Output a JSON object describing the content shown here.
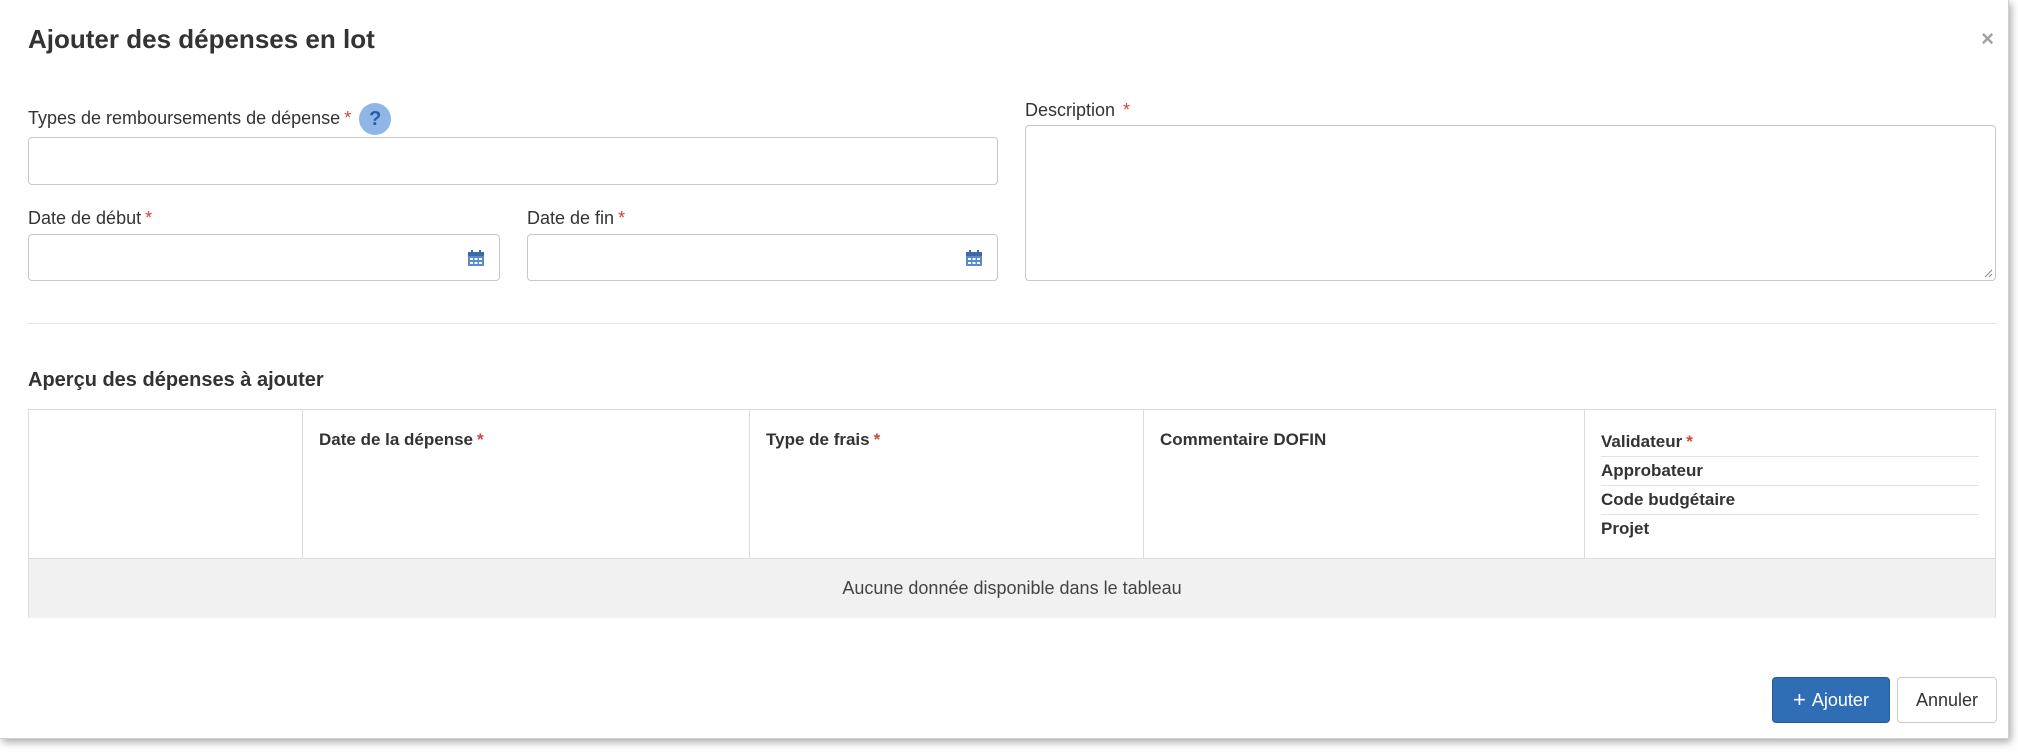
{
  "modal": {
    "title": "Ajouter des dépenses en lot",
    "close_symbol": "×"
  },
  "form": {
    "types_label": "Types de remboursements de dépense",
    "types_value": "",
    "help_symbol": "?",
    "start_label": "Date de début",
    "start_value": "",
    "end_label": "Date de fin",
    "end_value": "",
    "description_label": "Description",
    "description_value": "",
    "required_marker": "*"
  },
  "preview": {
    "title": "Aperçu des dépenses à ajouter",
    "columns": [
      {
        "label": ""
      },
      {
        "label": "Date de la dépense",
        "required": true
      },
      {
        "label": "Type de frais",
        "required": true
      },
      {
        "label": "Commentaire DOFIN"
      }
    ],
    "stacked_column": [
      "Validateur",
      "Approbateur",
      "Code budgétaire",
      "Projet"
    ],
    "empty_message": "Aucune donnée disponible dans le tableau"
  },
  "footer": {
    "add_label": "Ajouter",
    "cancel_label": "Annuler"
  },
  "icons": {
    "close": "close-icon",
    "help": "help-icon",
    "calendar": "calendar-icon",
    "plus": "plus-icon"
  },
  "colors": {
    "primary": "#2f6db5",
    "required": "#d2443a",
    "help_bg": "#8fb6e6"
  }
}
